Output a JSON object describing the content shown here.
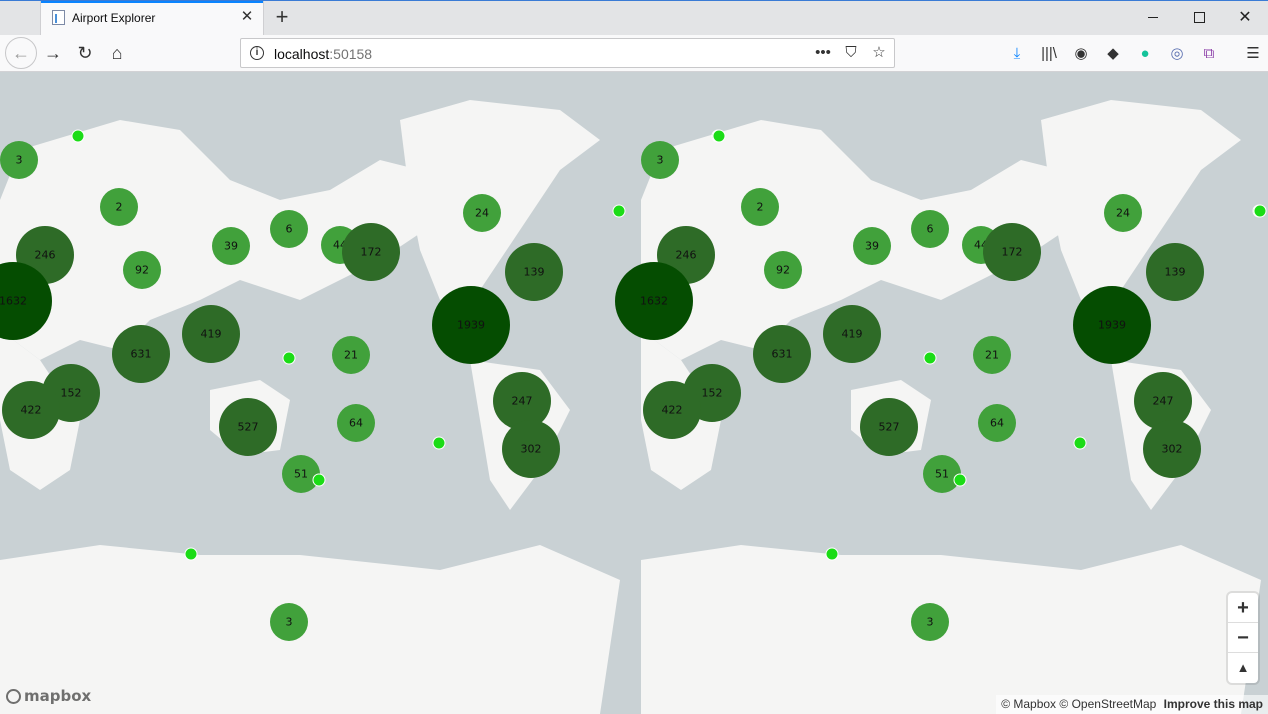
{
  "browser": {
    "tab_title": "Airport Explorer",
    "url_host": "localhost",
    "url_port": ":50158"
  },
  "map": {
    "attribution": [
      "© Mapbox",
      "© OpenStreetMap"
    ],
    "improve_link": "Improve this map",
    "logo_text": "mapbox",
    "cluster_color_small": "#41a13b",
    "cluster_color_medium": "#2e6b27",
    "cluster_color_large": "#054d01",
    "point_color": "#1bdc16",
    "clusters": [
      "3",
      "2",
      "246",
      "1632",
      "92",
      "39",
      "6",
      "44",
      "172",
      "24",
      "139",
      "1939",
      "419",
      "631",
      "21",
      "247",
      "152",
      "422",
      "527",
      "64",
      "302",
      "51",
      "3"
    ]
  }
}
